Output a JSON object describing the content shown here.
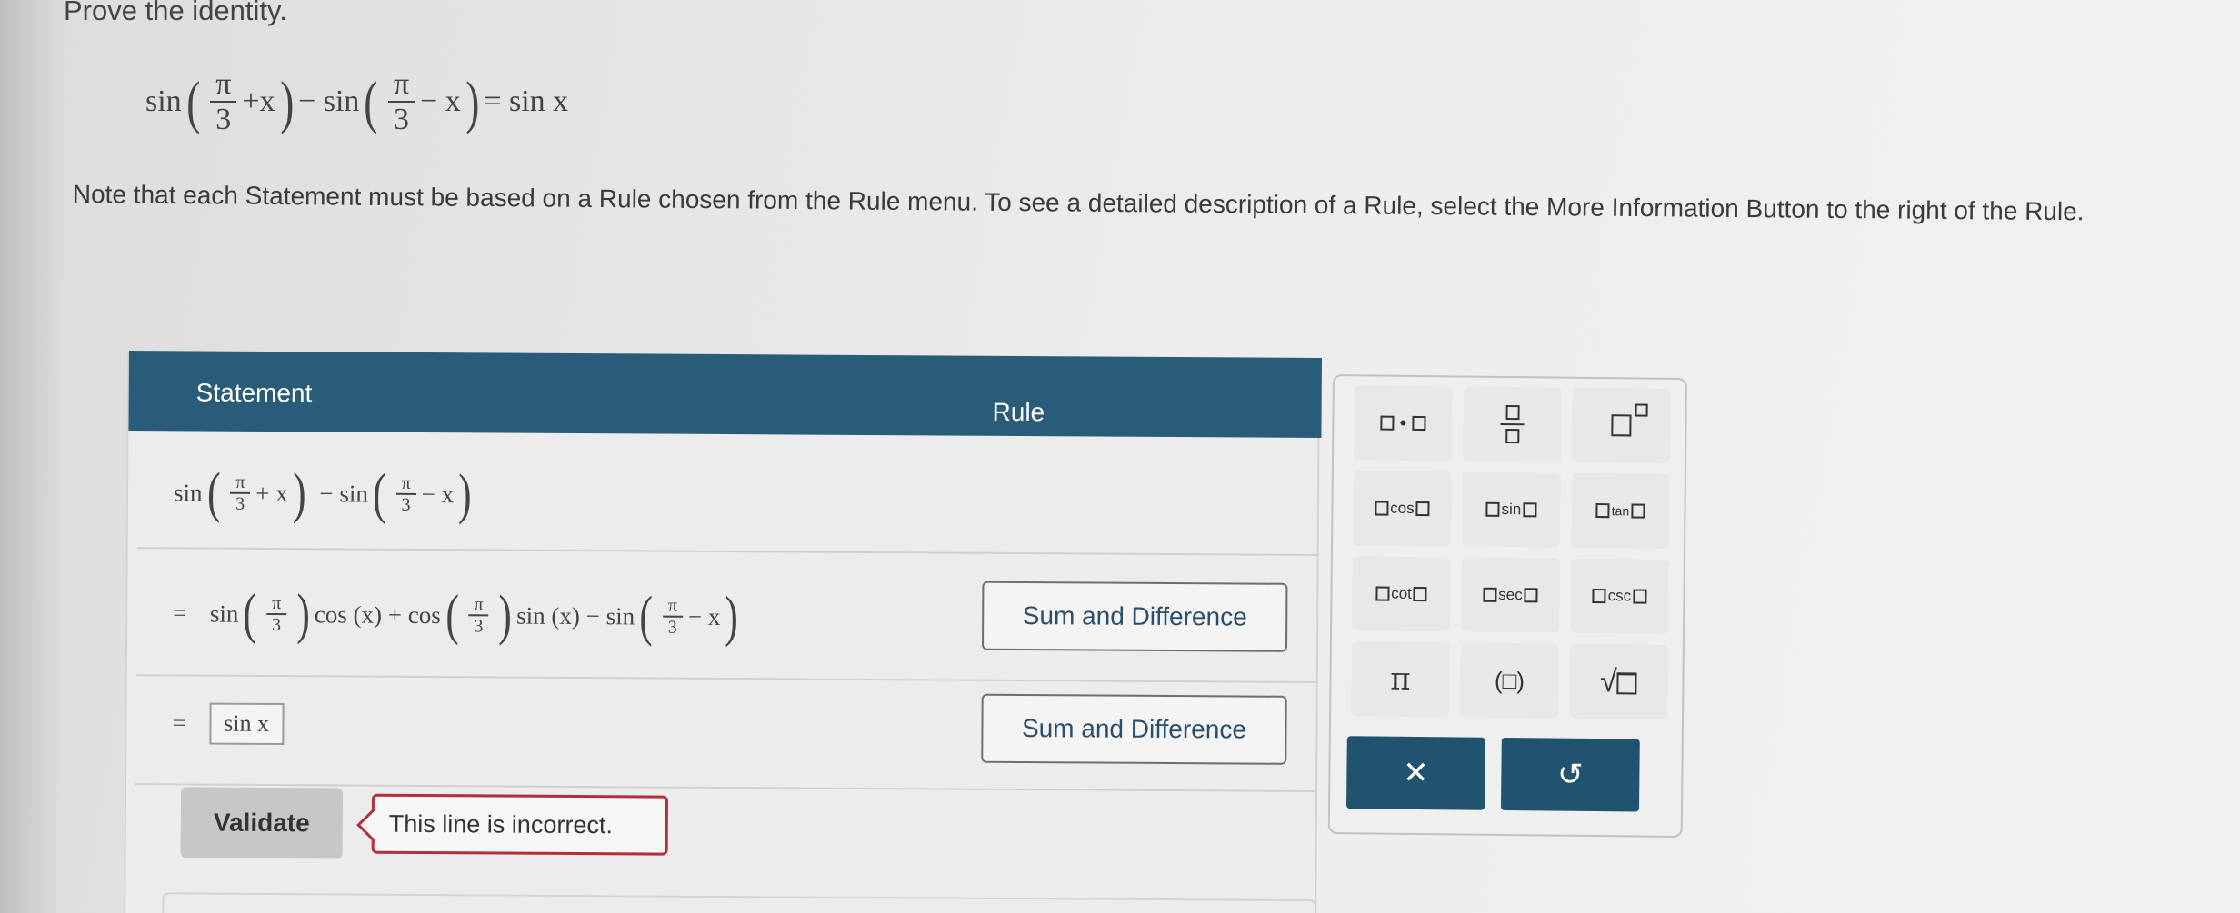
{
  "prompt": {
    "title": "Prove the identity.",
    "identity": {
      "sin1": "sin",
      "pi": "π",
      "three": "3",
      "plus_x": "+x",
      "minus_sin": "− sin",
      "minus_x": "− x",
      "rhs": "= sin x"
    },
    "note": "Note that each Statement must be based on a Rule chosen from the Rule menu. To see a detailed description of a Rule, select the More Information Button to the right of the Rule."
  },
  "proof": {
    "header": {
      "statement": "Statement",
      "rule": "Rule"
    },
    "rows": [
      {
        "sin_a": "sin",
        "pi": "π",
        "three": "3",
        "plus_x": "+ x",
        "minus_sin": "− sin",
        "minus_x": "− x"
      },
      {
        "eq": "=",
        "sin_a": "sin",
        "pi": "π",
        "three": "3",
        "cos_x": "cos (x) + cos",
        "sin_x": "sin (x) − sin",
        "minus_x": "− x",
        "rule": "Sum and Difference"
      },
      {
        "eq": "=",
        "answer": "sin x",
        "rule": "Sum and Difference"
      }
    ],
    "validate_label": "Validate",
    "error_message": "This line is incorrect."
  },
  "keypad": {
    "keys": {
      "cos": "cos",
      "sin": "sin",
      "tan": "tan",
      "cot": "cot",
      "sec": "sec",
      "csc": "csc",
      "pi": "π",
      "abs": "(□)",
      "sqrt": "√"
    },
    "clear_label": "✕",
    "undo_label": "↺"
  }
}
